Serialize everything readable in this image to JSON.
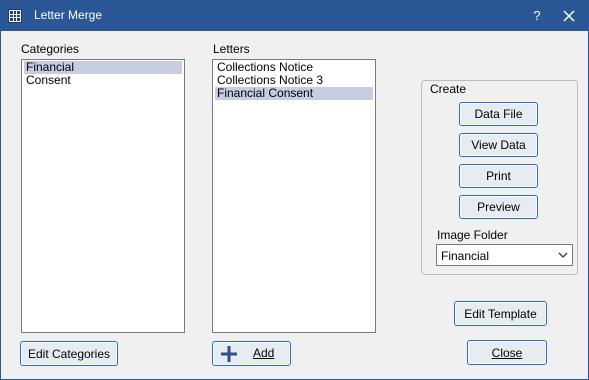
{
  "window": {
    "title": "Letter Merge",
    "help_label": "?"
  },
  "categories": {
    "label": "Categories",
    "items": [
      "Financial",
      "Consent"
    ],
    "selected_index": 0,
    "edit_button_label": "Edit Categories"
  },
  "letters": {
    "label": "Letters",
    "items": [
      "Collections Notice",
      "Collections Notice 3",
      "Financial Consent"
    ],
    "selected_index": 2,
    "add_button_label": "Add"
  },
  "create": {
    "group_label": "Create",
    "data_file_label": "Data File",
    "view_data_label": "View Data",
    "print_label": "Print",
    "preview_label": "Preview",
    "image_folder_label": "Image Folder",
    "image_folder_value": "Financial"
  },
  "actions": {
    "edit_template_label": "Edit Template",
    "close_label": "Close"
  },
  "colors": {
    "titlebar": "#2b5797",
    "selection": "#c5cde0",
    "accent_border": "#2d6bbf"
  }
}
